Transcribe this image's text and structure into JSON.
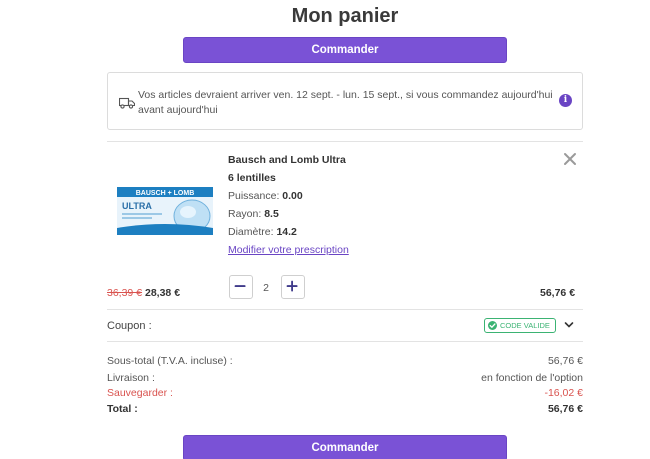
{
  "page": {
    "title": "Mon panier"
  },
  "actions": {
    "checkout_label": "Commander"
  },
  "delivery": {
    "message": "Vos articles devraient arriver ven. 12 sept. - lun. 15 sept., si vous commandez aujourd'hui avant aujourd'hui",
    "info_glyph": "i"
  },
  "item": {
    "name": "Bausch and Lomb Ultra",
    "lenses": "6 lentilles",
    "specs": [
      {
        "label": "Puissance:",
        "value": "0.00"
      },
      {
        "label": "Rayon:",
        "value": "8.5"
      },
      {
        "label": "Diamètre:",
        "value": "14.2"
      }
    ],
    "modify_link": "Modifier votre prescription",
    "old_price": "36,39 €",
    "price": "28,38 €",
    "quantity": "2",
    "line_total": "56,76 €",
    "image": {
      "brand": "BAUSCH + LOMB",
      "product": "ULTRA"
    }
  },
  "coupon": {
    "label": "Coupon :",
    "badge": "CODE VALIDE"
  },
  "summary": {
    "subtotal_label": "Sous-total (T.V.A. incluse) :",
    "subtotal_value": "56,76 €",
    "shipping_label": "Livraison :",
    "shipping_value": "en fonction de l'option",
    "savings_label": "Sauvegarder :",
    "savings_value": "-16,02 €",
    "total_label": "Total :",
    "total_value": "56,76 €"
  },
  "colors": {
    "accent": "#7a52d6",
    "valid": "#3bb373",
    "discount": "#d9534f"
  },
  "icons": {
    "truck": "truck-icon",
    "info": "info-icon",
    "close": "close-icon",
    "minus": "minus-icon",
    "plus": "plus-icon",
    "check": "check-icon",
    "chevron": "chevron-down-icon"
  }
}
